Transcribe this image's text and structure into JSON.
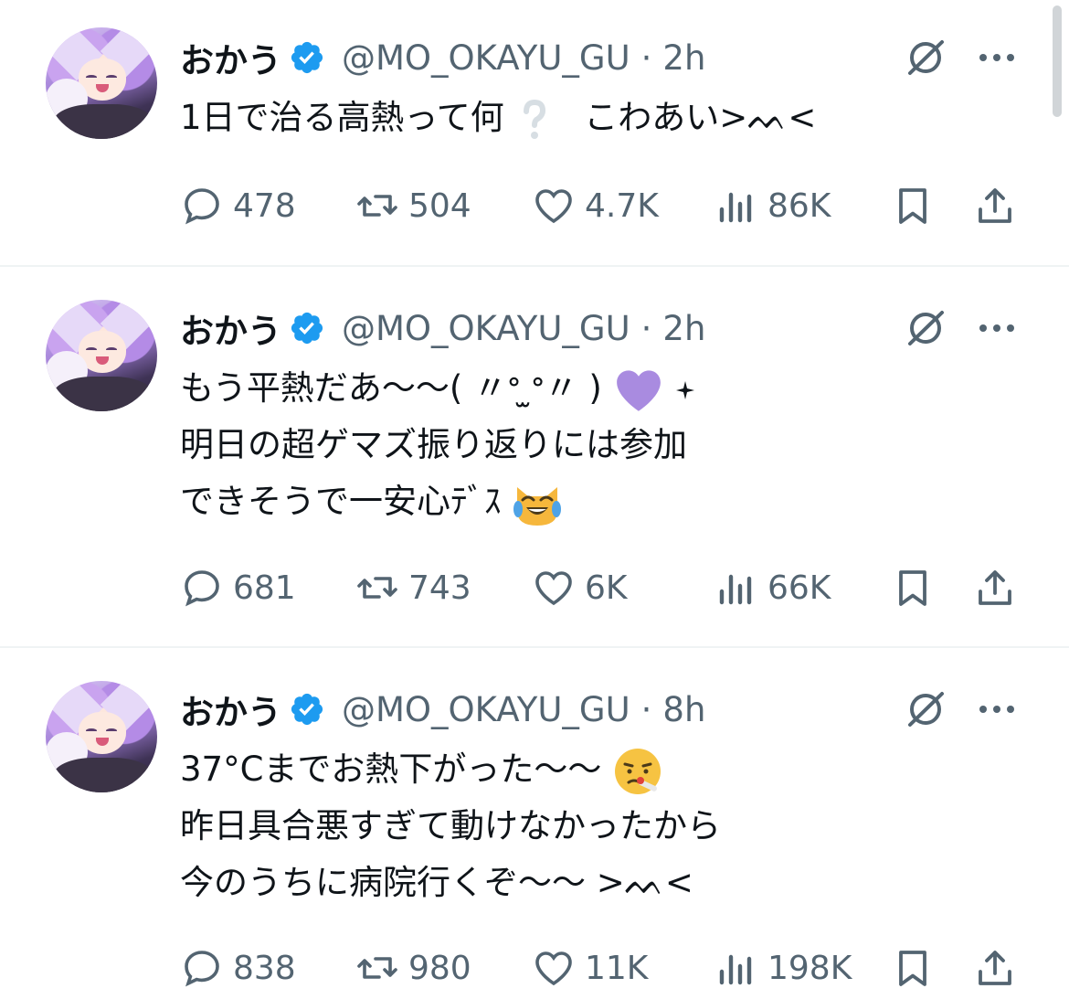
{
  "tweets": [
    {
      "author": {
        "name": "おかう",
        "handle": "@MO_OKAYU_GU",
        "separator": "·",
        "time": "2h"
      },
      "lines": [
        "1日で治る高熱って何",
        "こわあい>ᨓ<"
      ],
      "stats": {
        "replies": "478",
        "reposts": "504",
        "likes": "4.7K",
        "views": "86K"
      }
    },
    {
      "author": {
        "name": "おかう",
        "handle": "@MO_OKAYU_GU",
        "separator": "·",
        "time": "2h"
      },
      "lines": [
        "もう平熱だあ〜〜( 〃ᐤ ̫ᐤ〃 )",
        "明日の超ゲマズ振り返りには参加",
        "できそうで一安心ﾃﾞｽ"
      ],
      "stats": {
        "replies": "681",
        "reposts": "743",
        "likes": "6K",
        "views": "66K"
      }
    },
    {
      "author": {
        "name": "おかう",
        "handle": "@MO_OKAYU_GU",
        "separator": "·",
        "time": "8h"
      },
      "lines": [
        "37°Cまでお熱下がった〜〜",
        "昨日具合悪すぎて動けなかったから",
        "今のうちに病院行くぞ〜〜 >ᨓ<"
      ],
      "stats": {
        "replies": "838",
        "reposts": "980",
        "likes": "11K",
        "views": "198K"
      }
    }
  ],
  "icons": {
    "verified": "verified-badge-icon",
    "grok": "grok-icon",
    "more": "more-icon",
    "reply": "reply-icon",
    "repost": "repost-icon",
    "like": "heart-icon",
    "views": "views-icon",
    "bookmark": "bookmark-icon",
    "share": "share-icon"
  },
  "colors": {
    "verified": "#1d9bf0",
    "meta": "#536471",
    "text": "#0f1419",
    "divider": "#eff3f4"
  }
}
